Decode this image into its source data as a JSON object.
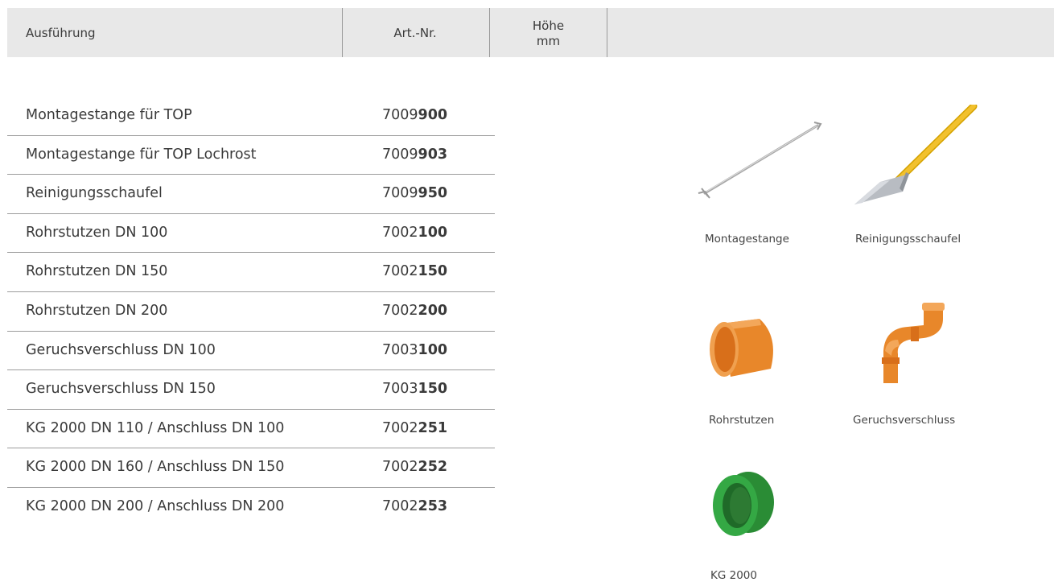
{
  "header": {
    "col_ausfuehrung": "Ausführung",
    "col_artnr": "Art.-Nr.",
    "col_hoehe": "Höhe",
    "col_hoehe_unit": "mm"
  },
  "rows": [
    {
      "name": "Montagestange für TOP",
      "art_prefix": "7009",
      "art_suffix": "900"
    },
    {
      "name": "Montagestange für TOP Lochrost",
      "art_prefix": "7009",
      "art_suffix": "903"
    },
    {
      "name": "Reinigungsschaufel",
      "art_prefix": "7009",
      "art_suffix": "950"
    },
    {
      "name": "Rohrstutzen DN 100",
      "art_prefix": "7002",
      "art_suffix": "100"
    },
    {
      "name": "Rohrstutzen DN 150",
      "art_prefix": "7002",
      "art_suffix": "150"
    },
    {
      "name": "Rohrstutzen DN 200",
      "art_prefix": "7002",
      "art_suffix": "200"
    },
    {
      "name": "Geruchsverschluss DN 100",
      "art_prefix": "7003",
      "art_suffix": "100"
    },
    {
      "name": "Geruchsverschluss DN 150",
      "art_prefix": "7003",
      "art_suffix": "150"
    },
    {
      "name": "KG 2000 DN 110 / Anschluss DN 100",
      "art_prefix": "7002",
      "art_suffix": "251"
    },
    {
      "name": "KG 2000 DN 160 / Anschluss DN 150",
      "art_prefix": "7002",
      "art_suffix": "252"
    },
    {
      "name": "KG 2000 DN 200 / Anschluss DN 200",
      "art_prefix": "7002",
      "art_suffix": "253"
    }
  ],
  "products": {
    "montagestange": "Montagestange",
    "reinigungsschaufel": "Reinigungsschaufel",
    "rohrstutzen": "Rohrstutzen",
    "geruchsverschluss": "Geruchsverschluss",
    "kg2000": "KG 2000"
  },
  "colors": {
    "header_bg": "#e8e8e8",
    "pipe_orange": "#e8872a",
    "ring_green": "#2e9a3c",
    "handle_yellow": "#f2c12e"
  }
}
